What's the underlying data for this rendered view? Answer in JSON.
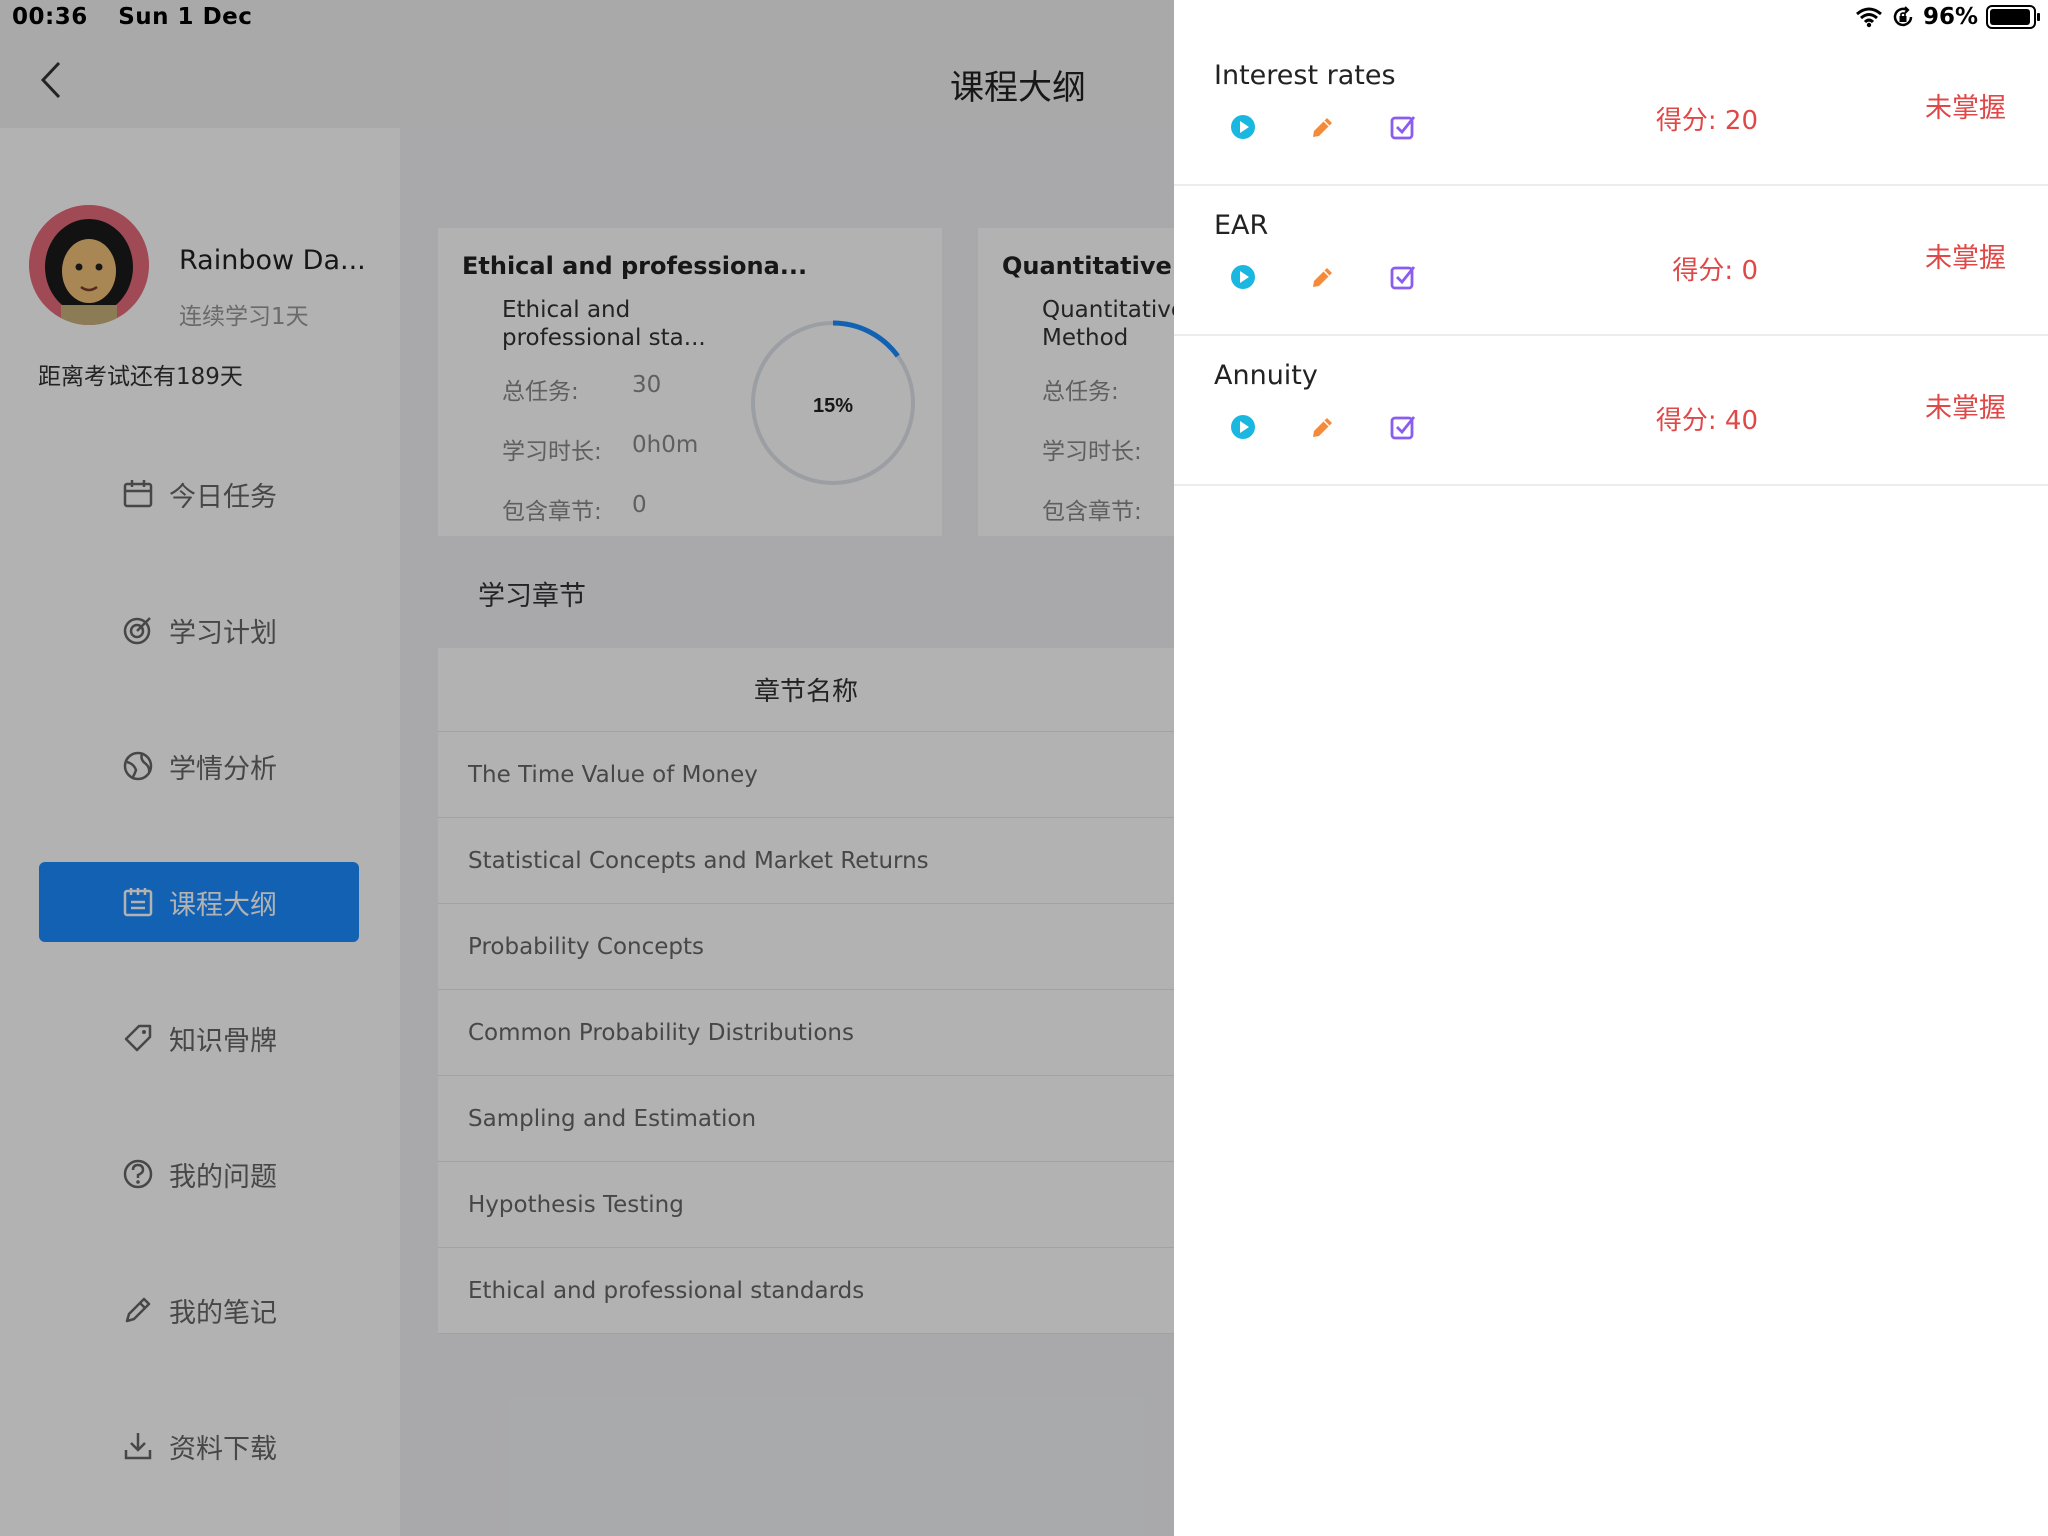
{
  "status_bar": {
    "time": "00:36",
    "date": "Sun 1 Dec",
    "battery": "96%"
  },
  "header": {
    "title": "课程大纲"
  },
  "profile": {
    "name": "Rainbow Da...",
    "streak": "连续学习1天",
    "exam_countdown": "距离考试还有189天"
  },
  "nav": [
    {
      "label": "今日任务",
      "icon": "calendar-icon",
      "active": false
    },
    {
      "label": "学习计划",
      "icon": "target-icon",
      "active": false
    },
    {
      "label": "学情分析",
      "icon": "globe-icon",
      "active": false
    },
    {
      "label": "课程大纲",
      "icon": "syllabus-icon",
      "active": true
    },
    {
      "label": "知识骨牌",
      "icon": "tag-icon",
      "active": false
    },
    {
      "label": "我的问题",
      "icon": "question-icon",
      "active": false
    },
    {
      "label": "我的笔记",
      "icon": "pencil-icon",
      "active": false
    },
    {
      "label": "资料下载",
      "icon": "download-icon",
      "active": false
    }
  ],
  "cards": [
    {
      "title": "Ethical and professiona...",
      "subtitle": "Ethical and professional sta...",
      "total_tasks_label": "总任务:",
      "total_tasks": "30",
      "duration_label": "学习时长:",
      "duration": "0h0m",
      "chapters_label": "包含章节:",
      "chapters": "0",
      "progress": "15%",
      "progress_fraction": 0.15
    },
    {
      "title": "Quantitative M",
      "subtitle": "Quantitative Method",
      "total_tasks_label": "总任务:",
      "duration_label": "学习时长:",
      "chapters_label": "包含章节:"
    }
  ],
  "chapters_section": {
    "label": "学习章节",
    "column_header": "章节名称",
    "rows": [
      "The Time Value of  Money",
      "Statistical Concepts and Market Returns",
      "Probability Concepts",
      "Common Probability Distributions",
      "Sampling and Estimation",
      "Hypothesis Testing",
      "Ethical and professional standards"
    ]
  },
  "drawer": {
    "topics": [
      {
        "name": "Interest rates",
        "score": "得分: 20",
        "status": "未掌握"
      },
      {
        "name": "EAR",
        "score": "得分: 0",
        "status": "未掌握"
      },
      {
        "name": "Annuity",
        "score": "得分: 40",
        "status": "未掌握"
      }
    ],
    "action_icons": [
      "play-icon",
      "edit-icon",
      "checkbox-icon"
    ]
  },
  "colors": {
    "accent": "#1a8cff",
    "danger": "#e04848",
    "play": "#1ab8e0",
    "edit": "#f58a3a",
    "check": "#8a5cf0"
  }
}
